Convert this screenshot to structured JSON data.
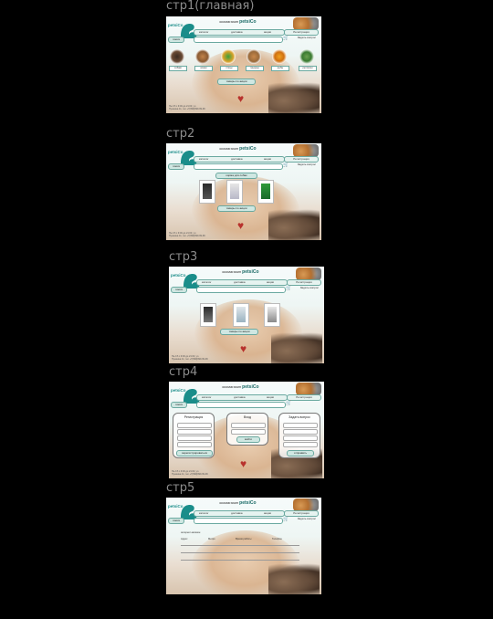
{
  "pages": [
    {
      "label": "стр1(главная)"
    },
    {
      "label": "стр2"
    },
    {
      "label": "стр3"
    },
    {
      "label": "стр4"
    },
    {
      "label": "стр5"
    }
  ],
  "site": {
    "logo": "petsiCo",
    "header": "зоомагазин",
    "header_brand": "petsiCo",
    "nav": [
      "каталог",
      "доставка",
      "акции"
    ],
    "auth": "Регистрация",
    "enter": "войти",
    "ask": "Задать вопрос",
    "search_btn": "поиск",
    "footer": "Пн-Сб с 9:00 до 21:00, ул. Пушкина 11, тел +7(999)999-99-99",
    "cart_icon": "cart-icon"
  },
  "page1": {
    "animals": [
      "собаки",
      "кошки",
      "птицы",
      "грызуны",
      "рыбы",
      "рептилии"
    ],
    "center_btn": "товары по акции"
  },
  "page2": {
    "products_label": "корма для собак",
    "center_btn": "товары по акции"
  },
  "page3": {
    "center_btn": "товары по акции"
  },
  "page4": {
    "reg_title": "Регистрация",
    "login_title": "Вход",
    "ask_title": "Задать вопрос",
    "reg_btn": "зарегистрироваться",
    "login_btn": "войти",
    "ask_btn": "отправить"
  },
  "page5": {
    "table_title": "интернет-магазин",
    "cols": [
      "Адрес",
      "Метро",
      "Время работы",
      "Телефон"
    ]
  },
  "colors": {
    "accent": "#1a8d8a",
    "heart": "#b8322d"
  }
}
